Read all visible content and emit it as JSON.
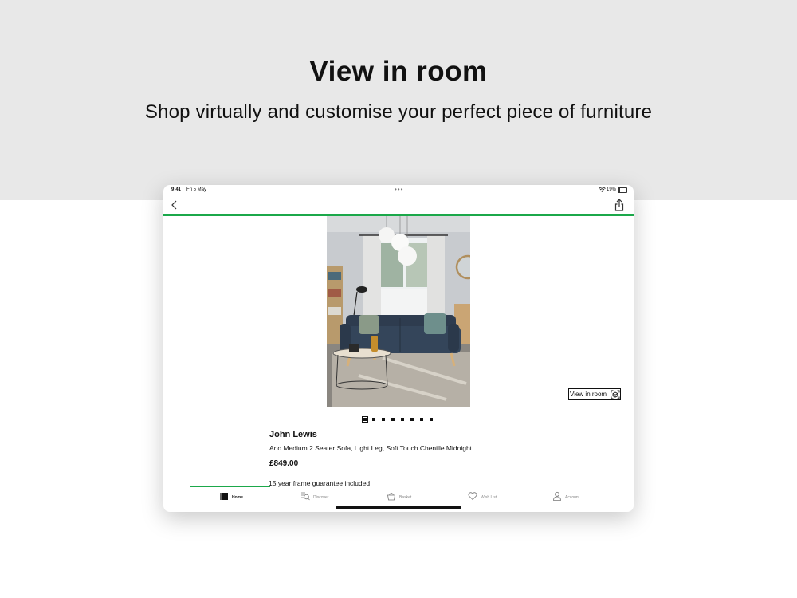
{
  "hero": {
    "title": "View in room",
    "subtitle": "Shop virtually and customise your perfect piece of furniture"
  },
  "status_bar": {
    "time": "9:41",
    "date": "Fri 5 May",
    "battery": "19%",
    "battery_level": 0.19
  },
  "icons": {
    "back": "chevron-left-icon",
    "share": "share-icon",
    "view_in_room": "ar-cube-icon",
    "wifi": "wifi-icon",
    "battery": "battery-icon"
  },
  "product": {
    "brand": "John Lewis",
    "name": "Arlo Medium 2 Seater Sofa, Light Leg, Soft Touch Chenille Midnight",
    "price": "£849.00",
    "guarantee": "15 year frame guarantee included",
    "view_in_room_label": "View in room"
  },
  "carousel": {
    "count": 8,
    "active": 0
  },
  "colors": {
    "accent": "#1ba84a",
    "sofa": "#2e3c4f",
    "wall": "#c9ccd0",
    "floor": "#8f8a82"
  },
  "tab_bar": {
    "items": [
      {
        "label": "Home",
        "icon": "home-icon",
        "active": true
      },
      {
        "label": "Discover",
        "icon": "discover-search-icon",
        "active": false
      },
      {
        "label": "Basket",
        "icon": "basket-icon",
        "active": false
      },
      {
        "label": "Wish List",
        "icon": "heart-icon",
        "active": false
      },
      {
        "label": "Account",
        "icon": "account-person-icon",
        "active": false
      }
    ]
  }
}
